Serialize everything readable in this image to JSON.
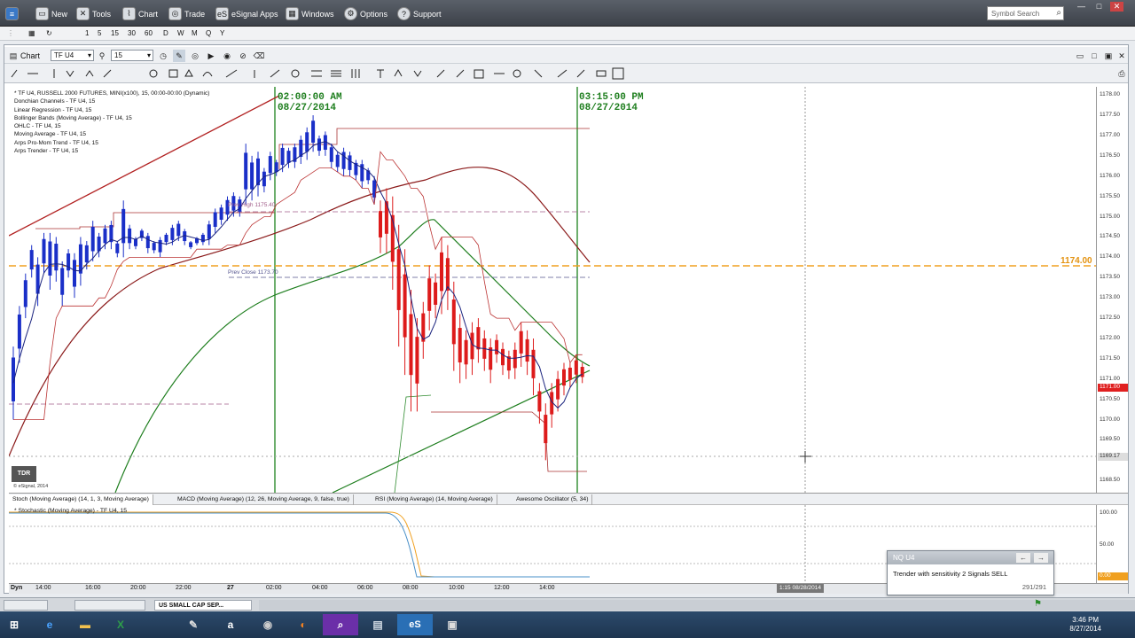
{
  "topbar": {
    "items": [
      {
        "label": "New",
        "icon": "new-window-icon"
      },
      {
        "label": "Tools",
        "icon": "tools-icon"
      },
      {
        "label": "Chart",
        "icon": "chart-icon"
      },
      {
        "label": "Trade",
        "icon": "trade-icon"
      },
      {
        "label": "eSignal Apps",
        "icon": "esignal-apps-icon"
      },
      {
        "label": "Windows",
        "icon": "windows-icon"
      },
      {
        "label": "Options",
        "icon": "gear-icon"
      },
      {
        "label": "Support",
        "icon": "help-icon"
      }
    ],
    "search_placeholder": "Symbol Search"
  },
  "intervals": [
    "1",
    "5",
    "15",
    "30",
    "60",
    "D",
    "W",
    "M",
    "Q",
    "Y"
  ],
  "chart_window": {
    "title": "Chart",
    "symbol": "TF U4",
    "interval": "15"
  },
  "legend": [
    "* TF U4, RUSSELL 2000 FUTURES, MINI(x100), 15, 00:00-00:00 (Dynamic)",
    "Donchian Channels - TF U4, 15",
    "Linear Regression - TF U4, 15",
    "Bollinger Bands (Moving Average) - TF U4, 15",
    "OHLC - TF U4, 15",
    "Moving Average - TF U4, 15",
    "Arps Pro-Mom Trend - TF U4, 15",
    "Arps Trender - TF U4, 15"
  ],
  "annotations": {
    "line1_time": "02:00:00 AM",
    "line1_date": "08/27/2014",
    "line2_time": "03:15:00 PM",
    "line2_date": "08/27/2014",
    "prev_high": "Prev High 1175.40",
    "prev_close": "Prev Close 1173.70",
    "level_label": "1174.00",
    "last_price": "1171.00",
    "crosshair_price": "1169.17",
    "crosshair_time": "1:15 08/28/2014",
    "copyright": "© eSignal, 2014",
    "logo_text": "TDR"
  },
  "price_ticks": [
    "1178.00",
    "1177.50",
    "1177.00",
    "1176.50",
    "1176.00",
    "1175.50",
    "1175.00",
    "1174.50",
    "1174.00",
    "1173.50",
    "1173.00",
    "1172.50",
    "1172.00",
    "1171.50",
    "1171.00",
    "1170.50",
    "1170.00",
    "1169.50",
    "1169.00",
    "1168.50"
  ],
  "study_tabs": [
    "Stoch (Moving Average) (14, 1, 3, Moving Average)",
    "MACD (Moving Average) (12, 26, Moving Average, 9, false, true)",
    "RSI (Moving Average) (14, Moving Average)",
    "Awesome Oscillator (5, 34)"
  ],
  "lower_pane": {
    "title": "* Stochastic (Moving Average) - TF U4, 15",
    "ticks": [
      "100.00",
      "50.00",
      "0.00"
    ]
  },
  "time_labels": [
    "Dyn",
    "14:00",
    "16:00",
    "20:00",
    "22:00",
    "27",
    "02:00",
    "04:00",
    "06:00",
    "08:00",
    "10:00",
    "12:00",
    "14:00"
  ],
  "alert": {
    "symbol": "NQ U4",
    "message": "Trender with sensitivity 2 Signals SELL",
    "count": "291/291"
  },
  "dock_tabs": [
    "US SMALL CAP SEP..."
  ],
  "taskbar": {
    "apps": [
      "ie-icon",
      "explorer-icon",
      "excel-icon",
      "paint-icon",
      "amazon-icon",
      "media-icon",
      "firefox-icon",
      "search-app-icon",
      "network-icon",
      "esignal-icon",
      "floppy-icon"
    ],
    "time": "3:46 PM",
    "date": "8/27/2014"
  },
  "chart_data": {
    "type": "candlestick",
    "y_range": [
      1168.2,
      1178.2
    ],
    "level_line": 1174.0,
    "bars": [
      [
        1171.8,
        1170.0
      ],
      [
        1172.8,
        1171.4
      ],
      [
        1173.6,
        1172.5
      ],
      [
        1174.3,
        1173.5
      ],
      [
        1174.0,
        1172.8
      ],
      [
        1174.6,
        1173.6
      ],
      [
        1174.6,
        1173.2
      ],
      [
        1174.5,
        1173.4
      ],
      [
        1173.9,
        1172.8
      ],
      [
        1174.2,
        1173.5
      ],
      [
        1174.1,
        1173.0
      ],
      [
        1174.5,
        1173.3
      ],
      [
        1174.4,
        1173.7
      ],
      [
        1174.9,
        1173.9
      ],
      [
        1174.6,
        1174.0
      ],
      [
        1174.8,
        1174.2
      ],
      [
        1174.9,
        1174.2
      ],
      [
        1174.4,
        1174.0
      ],
      [
        1175.4,
        1174.0
      ],
      [
        1174.8,
        1174.2
      ],
      [
        1174.5,
        1174.2
      ],
      [
        1174.7,
        1174.4
      ],
      [
        1174.6,
        1174.1
      ],
      [
        1174.4,
        1174.1
      ],
      [
        1174.5,
        1174.0
      ],
      [
        1174.6,
        1174.3
      ],
      [
        1174.8,
        1174.3
      ],
      [
        1174.9,
        1174.4
      ],
      [
        1174.7,
        1174.3
      ],
      [
        1174.4,
        1174.2
      ],
      [
        1174.5,
        1174.3
      ],
      [
        1174.6,
        1174.3
      ],
      [
        1174.9,
        1174.3
      ],
      [
        1175.2,
        1174.6
      ],
      [
        1175.3,
        1174.8
      ],
      [
        1175.5,
        1174.9
      ],
      [
        1175.6,
        1175.0
      ],
      [
        1175.5,
        1175.0
      ],
      [
        1176.8,
        1175.3
      ],
      [
        1176.5,
        1175.4
      ],
      [
        1176.6,
        1175.5
      ],
      [
        1176.2,
        1175.6
      ],
      [
        1176.6,
        1175.9
      ],
      [
        1176.4,
        1176.0
      ],
      [
        1176.8,
        1176.1
      ],
      [
        1176.7,
        1176.2
      ],
      [
        1176.8,
        1176.2
      ],
      [
        1177.0,
        1176.3
      ],
      [
        1177.2,
        1176.4
      ],
      [
        1177.5,
        1176.6
      ],
      [
        1177.0,
        1176.5
      ],
      [
        1177.1,
        1176.5
      ],
      [
        1176.8,
        1176.2
      ],
      [
        1176.6,
        1176.1
      ],
      [
        1176.7,
        1176.0
      ],
      [
        1176.6,
        1176.0
      ],
      [
        1176.4,
        1175.9
      ],
      [
        1176.4,
        1175.7
      ],
      [
        1176.2,
        1175.8
      ],
      [
        1176.0,
        1175.3
      ],
      [
        1175.4,
        1174.1
      ],
      [
        1175.7,
        1174.1
      ],
      [
        1175.5,
        1173.2
      ],
      [
        1174.8,
        1171.8
      ],
      [
        1174.2,
        1171.1
      ],
      [
        1173.2,
        1170.2
      ],
      [
        1172.5,
        1170.2
      ],
      [
        1172.9,
        1171.5
      ],
      [
        1173.8,
        1172.2
      ],
      [
        1173.6,
        1172.5
      ],
      [
        1174.5,
        1172.6
      ],
      [
        1174.3,
        1172.7
      ],
      [
        1173.4,
        1171.2
      ],
      [
        1172.6,
        1170.9
      ],
      [
        1172.2,
        1171.0
      ],
      [
        1172.4,
        1171.1
      ],
      [
        1172.5,
        1171.4
      ],
      [
        1172.2,
        1171.2
      ],
      [
        1172.0,
        1170.9
      ],
      [
        1172.1,
        1171.4
      ],
      [
        1171.9,
        1171.1
      ],
      [
        1171.7,
        1171.0
      ],
      [
        1171.9,
        1171.0
      ],
      [
        1172.4,
        1171.3
      ],
      [
        1172.2,
        1171.1
      ],
      [
        1172.0,
        1170.6
      ],
      [
        1170.9,
        1169.9
      ],
      [
        1170.4,
        1169.0
      ],
      [
        1170.9,
        1169.8
      ],
      [
        1171.2,
        1170.2
      ],
      [
        1171.4,
        1170.6
      ],
      [
        1171.4,
        1170.8
      ],
      [
        1171.6,
        1170.9
      ],
      [
        1171.4,
        1170.9
      ]
    ]
  }
}
